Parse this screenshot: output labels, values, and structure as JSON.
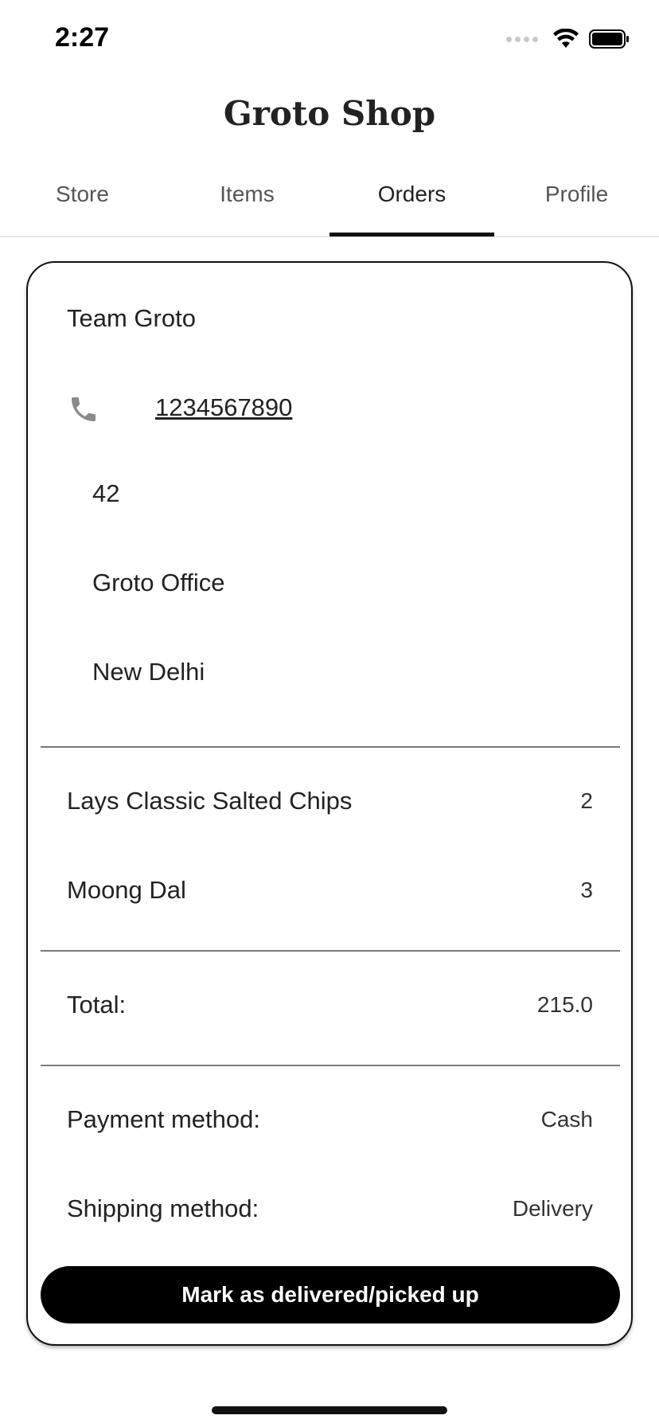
{
  "status_bar": {
    "time": "2:27",
    "icons": [
      "cellular-signal-icon",
      "wifi-icon",
      "battery-icon"
    ]
  },
  "app": {
    "title": "Groto Shop"
  },
  "tabs": [
    {
      "label": "Store",
      "active": false
    },
    {
      "label": "Items",
      "active": false
    },
    {
      "label": "Orders",
      "active": true
    },
    {
      "label": "Profile",
      "active": false
    }
  ],
  "order": {
    "customer_name": "Team Groto",
    "phone": "1234567890",
    "phone_icon": "phone-icon",
    "address_lines": [
      "42",
      "Groto Office",
      "New Delhi"
    ],
    "items": [
      {
        "name": "Lays Classic Salted Chips",
        "qty": "2"
      },
      {
        "name": "Moong Dal",
        "qty": "3"
      }
    ],
    "total_label": "Total:",
    "total_value": "215.0",
    "payment_label": "Payment method:",
    "payment_value": "Cash",
    "shipping_label": "Shipping method:",
    "shipping_value": "Delivery",
    "action_label": "Mark as delivered/picked up"
  },
  "colors": {
    "accent": "#000000",
    "text": "#222222",
    "divider": "#7a7a7a",
    "icon": "#8a8a8a"
  }
}
